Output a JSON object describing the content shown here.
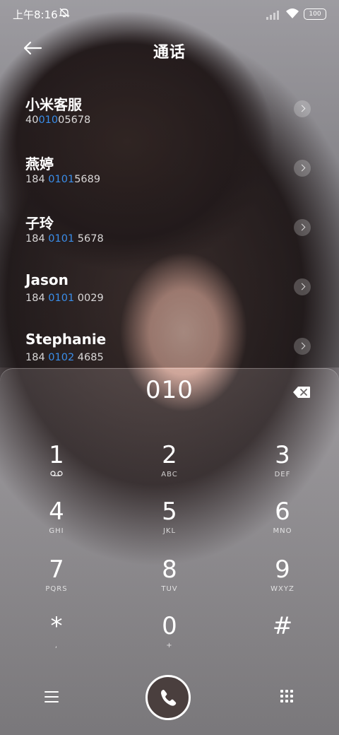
{
  "status_bar": {
    "time": "上午8:16",
    "battery": "100"
  },
  "header": {
    "title": "通话"
  },
  "contacts": [
    {
      "name": "小米客服",
      "num_pre": "40",
      "num_hl": "010",
      "num_post": "05678"
    },
    {
      "name": "燕婷",
      "num_pre": "184 ",
      "num_hl": "0101",
      "num_post": "5689"
    },
    {
      "name": "子玲",
      "num_pre": "184 ",
      "num_hl": "0101",
      "num_post": " 5678"
    },
    {
      "name": "Jason",
      "num_pre": "184 ",
      "num_hl": "0101",
      "num_post": " 0029"
    },
    {
      "name": "Stephanie",
      "num_pre": "184 ",
      "num_hl": "0102",
      "num_post": " 4685"
    }
  ],
  "dialer": {
    "input": "010",
    "keys": [
      {
        "digit": "1",
        "letters": ""
      },
      {
        "digit": "2",
        "letters": "ABC"
      },
      {
        "digit": "3",
        "letters": "DEF"
      },
      {
        "digit": "4",
        "letters": "GHI"
      },
      {
        "digit": "5",
        "letters": "JKL"
      },
      {
        "digit": "6",
        "letters": "MNO"
      },
      {
        "digit": "7",
        "letters": "PQRS"
      },
      {
        "digit": "8",
        "letters": "TUV"
      },
      {
        "digit": "9",
        "letters": "WXYZ"
      },
      {
        "digit": "*",
        "letters": ","
      },
      {
        "digit": "0",
        "letters": "+"
      },
      {
        "digit": "#",
        "letters": ""
      }
    ]
  },
  "icons": {
    "status": [
      "mute-icon",
      "signal-icon",
      "wifi-icon",
      "battery-icon"
    ],
    "header": "back-arrow-icon",
    "voicemail": "voicemail-icon",
    "backspace": "backspace-icon",
    "bottom": [
      "menu-icon",
      "phone-icon",
      "keypad-icon"
    ]
  },
  "colors": {
    "match_highlight": "#3a8eea"
  }
}
